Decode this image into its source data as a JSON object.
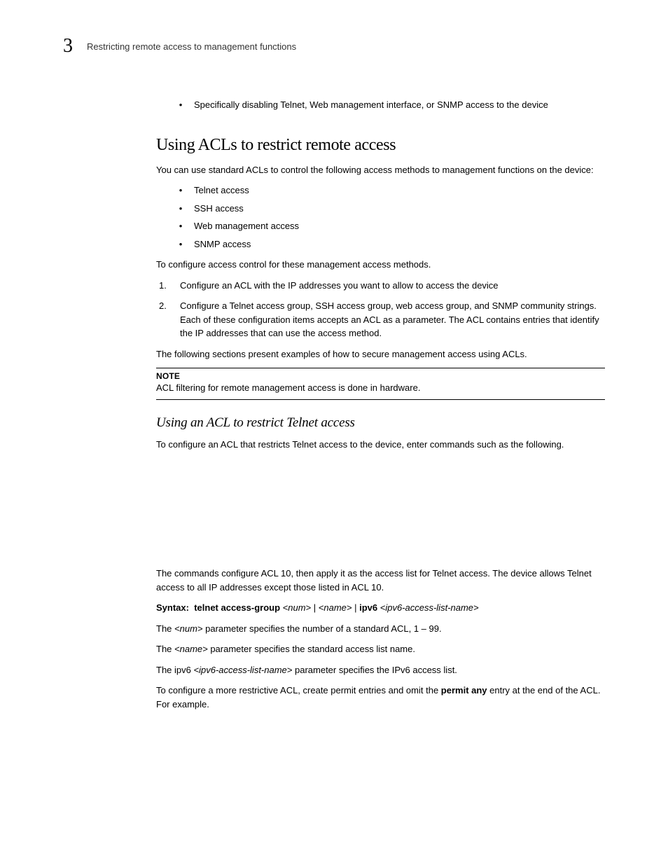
{
  "header": {
    "chapter": "3",
    "running_title": "Restricting remote access to management functions"
  },
  "intro_bullet": "Specifically disabling Telnet, Web management interface, or SNMP access to the device",
  "section": {
    "title": "Using ACLs to restrict remote access",
    "lead": "You can use standard ACLs to control the following access methods to management functions on the device:",
    "bullets": [
      "Telnet access",
      "SSH access",
      "Web management access",
      "SNMP access"
    ],
    "configure_lead": "To configure access control for these management access methods.",
    "steps": [
      "Configure an ACL with the IP addresses you want to allow to access the device",
      "Configure a Telnet access group, SSH access group, web access group, and SNMP community strings.  Each of these configuration items accepts an ACL as a parameter.  The ACL contains entries that identify the IP addresses that can use the access method."
    ],
    "following": "The following sections present examples of how to secure management access using ACLs.",
    "note_title": "NOTE",
    "note_body": "ACL filtering for remote management access is done in hardware."
  },
  "subsection": {
    "title": "Using an ACL to restrict Telnet access",
    "lead": "To configure an ACL that restricts Telnet access to the device, enter commands such as the following.",
    "after_code": "The commands configure ACL 10, then apply it as the access list for Telnet access.  The device allows Telnet access to all IP addresses except those listed in ACL 10.",
    "syntax": {
      "label": "Syntax:",
      "cmd": "telnet access-group",
      "num": "<num>",
      "pipe": " | ",
      "name": "<name>",
      "pipe2": "  |  ",
      "ipv6": "ipv6",
      "ipv6arg": "<ipv6-access-list-name>"
    },
    "p_num_a": "The ",
    "p_num_i": "<num>",
    "p_num_b": " parameter specifies the number of a standard ACL, 1 – 99.",
    "p_name_a": "The ",
    "p_name_i": "<name>",
    "p_name_b": " parameter specifies the standard access list name.",
    "p_ipv6_a": "The ipv6 ",
    "p_ipv6_i": "<ipv6-access-list-name>",
    "p_ipv6_b": " parameter specifies the IPv6 access list.",
    "restrictive_a": "To configure a more restrictive ACL, create permit entries and omit the ",
    "restrictive_bold": "permit any",
    "restrictive_b": " entry at the end of the ACL. For example."
  }
}
